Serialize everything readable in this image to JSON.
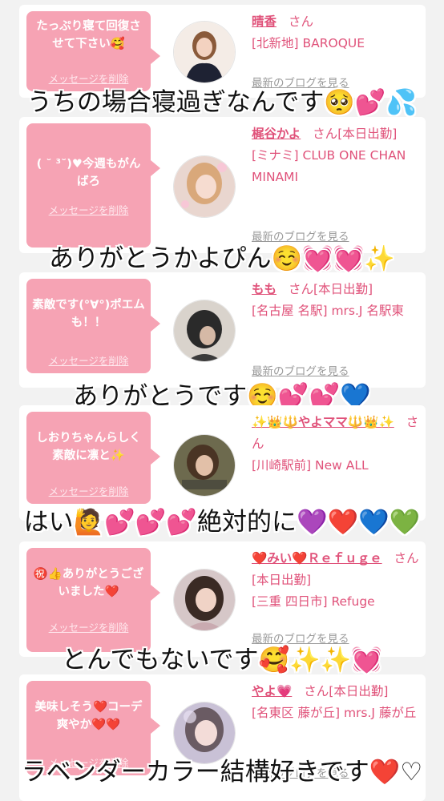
{
  "delete_label": "メッセージを削除",
  "blog_label": "最新のブログを見る",
  "san": "さん",
  "cards": [
    {
      "message": "たっぷり寝て回復させて下さい🥰",
      "name": "晴香",
      "status": "",
      "shop": "[北新地] BAROQUE",
      "caption": "うちの場合寝過ぎなんです🥺💕💦"
    },
    {
      "message": "( ˘ ³˘)♥今週もがんばろ",
      "name": "梶谷かよ",
      "status": "[本日出勤]",
      "shop": "[ミナミ] CLUB ONE CHAN MINAMI",
      "caption": "ありがとうかよぴん☺️💓💓✨"
    },
    {
      "message": "素敵です(°∀°)ポエムも！！",
      "name": "もも",
      "status": "[本日出勤]",
      "shop": "[名古屋 名駅] mrs.J 名駅東",
      "caption": "ありがとうです☺️💕💕💙"
    },
    {
      "message": "しおりちゃんらしく素敵に凛と✨",
      "name": "✨👑🔱やよママ🔱👑✨",
      "status": "",
      "shop": "[川崎駅前] New ALL",
      "caption": "はい🙋💕💕💕絶対的に💜❤️💙💚"
    },
    {
      "message": "㊗️👍ありがとうございました❤️",
      "name": "❤️みい❤️Ｒｅｆｕｇｅ",
      "status": "[本日出勤]",
      "shop": "[三重 四日市] Refuge",
      "caption": "とんでもないです🥰✨✨💓"
    },
    {
      "message": "美味しそう❤️コーデ爽やか❤️❤️",
      "name": "やよ💗",
      "status": "[本日出勤]",
      "shop": "[名東区 藤が丘] mrs.J 藤が丘",
      "caption": "ラベンダーカラー結構好きです❤️♡"
    }
  ],
  "colors": {
    "bubble": "#f6a3b4",
    "name": "#e0527a",
    "background": "#f2f2f2"
  }
}
